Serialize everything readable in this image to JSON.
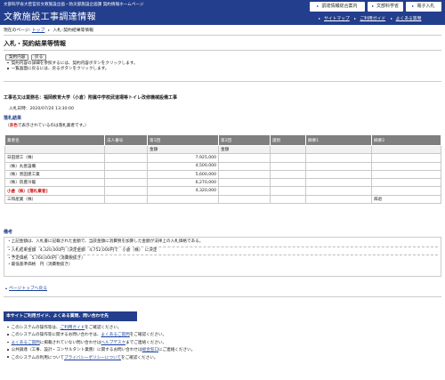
{
  "header": {
    "subtitle": "文部科学省大臣官房文教施設企画・防災部施設企画課 契約情報ホームページ",
    "title": "文教施設工事調達情報",
    "buttons": [
      "調達情報総合案内",
      "文部科学省",
      "電子入札"
    ],
    "links": [
      "サイトマップ",
      "ご利用ガイド",
      "よくある質問"
    ]
  },
  "breadcrumb": {
    "prefix": "現在のページ:",
    "top": "トップ",
    "current": "入札･契約結果等情報"
  },
  "page": {
    "title": "入札・契約結果等情報",
    "buttons": [
      "契約内容",
      "戻る"
    ],
    "notes": [
      "契約内容の詳細を参照するには、契約内容ボタンをクリックします。",
      "一覧画面に戻るには、戻るボタンをクリックします。"
    ]
  },
  "project": {
    "name": "工事名又は業務名：福岡教育大学（小倉）附属中学校武道場等トイレ改修機械設備工事",
    "date_label": "入札日時：",
    "date": "2020/07/20 13:30:00"
  },
  "result": {
    "heading": "落札結果",
    "legend_prefix": "（",
    "legend_red": "赤色",
    "legend_suffix": "で表示されているのは落札業者です。）"
  },
  "table": {
    "headers": [
      "業者名",
      "法人番号",
      "第1回",
      "第2回",
      "諸別",
      "摘要1",
      "摘要2"
    ],
    "subheaders": [
      "金額",
      "金額"
    ],
    "rows": [
      {
        "name": "日田建工（株）",
        "num": "",
        "r1": "7,925,000",
        "r2": "",
        "type": "",
        "n1": "",
        "n2": "",
        "winner": false
      },
      {
        "name": "（株）丸善設備",
        "num": "",
        "r1": "4,500,000",
        "r2": "",
        "type": "",
        "n1": "",
        "n2": "",
        "winner": false
      },
      {
        "name": "（株）黒田建工業",
        "num": "",
        "r1": "5,600,000",
        "r2": "",
        "type": "",
        "n1": "",
        "n2": "",
        "winner": false
      },
      {
        "name": "（株）筑豊冷暖",
        "num": "",
        "r1": "6,270,000",
        "r2": "",
        "type": "",
        "n1": "",
        "n2": "",
        "winner": false
      },
      {
        "name": "小倉（株）[落札業者]",
        "num": "",
        "r1": "4,320,000",
        "r2": "",
        "type": "",
        "n1": "",
        "n2": "",
        "winner": true
      },
      {
        "name": "三和産業（株）",
        "num": "",
        "r1": "",
        "r2": "",
        "type": "",
        "n1": "",
        "n2": "辞退",
        "winner": false
      }
    ]
  },
  "remarks": {
    "heading": "備考",
    "lines": [
      "・上記金額は、入札書に記載された金額で、当該金額に消費税を加算した金額が法律上の入札価格である。",
      "・入札結果金額　4,320,000円（決定金額　4,752,000円で　小倉（株）　に決定",
      "・予定価格　5,760,000円（消費税抜き）",
      "・最低基準価格　円（消費税抜き）"
    ]
  },
  "pagetop": "ページトップへ戻る",
  "guide": {
    "heading": "本サイトご利用ガイド、よくある質問、問い合わせ先",
    "lines": [
      [
        "このシステムの操作等は、",
        "ご利用ガイド",
        "をご確認ください。"
      ],
      [
        "このシステムの操作等に関するお問い合わせは、",
        "よくあるご質問",
        "をご確認ください。"
      ],
      [
        "",
        "よくあるご質問",
        "に掲載されていない問い合わせは",
        "ヘルプデスク",
        "までご連絡ください。"
      ],
      [
        "公共調達（工事、設計・コンサルタント業務）に関するお問い合わせは",
        "総合窓口",
        "にご連絡ください。"
      ],
      [
        "このシステムの利用について",
        "プライバシーポリシーについて",
        "をご確認ください。"
      ]
    ]
  }
}
